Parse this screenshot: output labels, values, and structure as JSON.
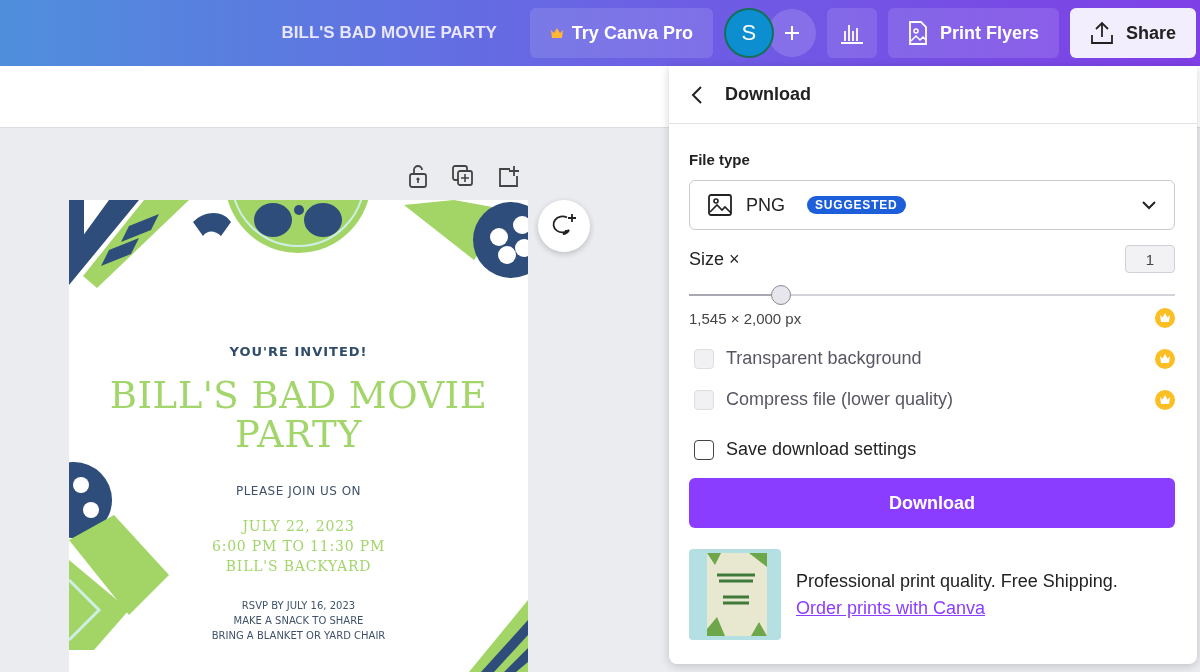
{
  "top_bar": {
    "design_title": "BILL'S BAD MOVIE PARTY",
    "try_pro_button": "Try Canva Pro",
    "avatar_initial": "S",
    "print_button": "Print Flyers",
    "share_button": "Share"
  },
  "flyer": {
    "kicker": "YOU'RE INVITED!",
    "title": "BILL'S BAD MOVIE PARTY",
    "intro": "PLEASE JOIN US ON",
    "event_lines": [
      "JULY 22, 2023",
      "6:00 PM TO 11:30 PM",
      "BILL'S BACKYARD"
    ],
    "note_lines": [
      "RSVP BY JULY 16, 2023",
      "MAKE A SNACK TO SHARE",
      "BRING A BLANKET OR YARD CHAIR"
    ]
  },
  "download_panel": {
    "title": "Download",
    "file_type_label": "File type",
    "file_type": {
      "value": "PNG",
      "badge": "SUGGESTED"
    },
    "size": {
      "label": "Size ×",
      "value": "1",
      "level": 0.19,
      "dimensions": "1,545 × 2,000 px",
      "pro": true
    },
    "options": [
      {
        "label": "Transparent background",
        "checked": false,
        "disabled": true,
        "pro": true
      },
      {
        "label": "Compress file (lower quality)",
        "checked": false,
        "disabled": true,
        "pro": true
      },
      {
        "label": "Save download settings",
        "checked": false,
        "disabled": false,
        "pro": false
      }
    ],
    "download_button": "Download",
    "promo": {
      "text": "Professional print quality. Free Shipping.",
      "link": "Order prints with Canva"
    }
  }
}
